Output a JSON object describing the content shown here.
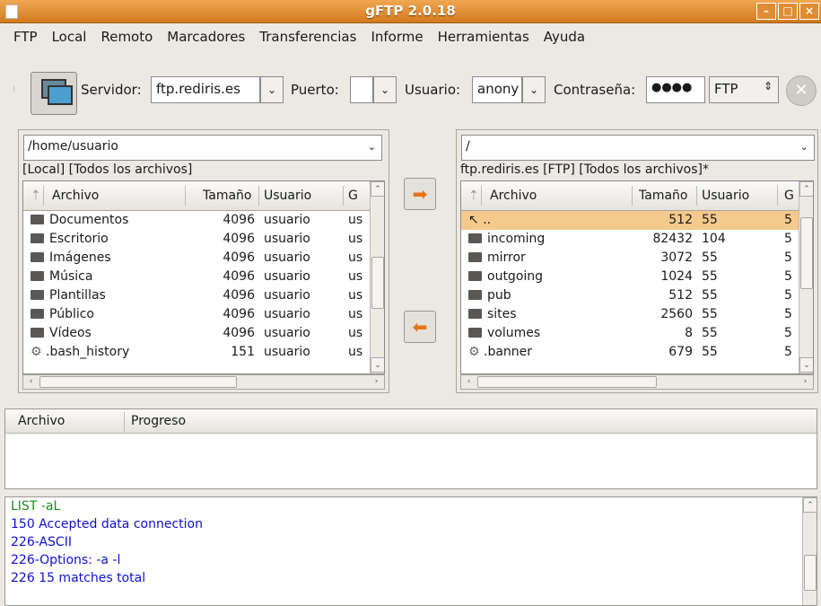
{
  "window": {
    "title": "gFTP 2.0.18"
  },
  "menu": [
    "FTP",
    "Local",
    "Remoto",
    "Marcadores",
    "Transferencias",
    "Informe",
    "Herramientas",
    "Ayuda"
  ],
  "toolbar": {
    "server_label": "Servidor:",
    "server_value": "ftp.rediris.es",
    "port_label": "Puerto:",
    "port_value": "",
    "user_label": "Usuario:",
    "user_value": "anony",
    "password_label": "Contraseña:",
    "password_value": "●●●●",
    "protocol": "FTP"
  },
  "local": {
    "path": "/home/usuario",
    "status": "[Local] [Todos los archivos]",
    "columns": [
      "Archivo",
      "Tamaño",
      "Usuario",
      "G"
    ],
    "files": [
      {
        "name": "Documentos",
        "size": "4096",
        "user": "usuario",
        "group": "us",
        "type": "folder"
      },
      {
        "name": "Escritorio",
        "size": "4096",
        "user": "usuario",
        "group": "us",
        "type": "folder"
      },
      {
        "name": "Imágenes",
        "size": "4096",
        "user": "usuario",
        "group": "us",
        "type": "folder"
      },
      {
        "name": "Música",
        "size": "4096",
        "user": "usuario",
        "group": "us",
        "type": "folder"
      },
      {
        "name": "Plantillas",
        "size": "4096",
        "user": "usuario",
        "group": "us",
        "type": "folder"
      },
      {
        "name": "Público",
        "size": "4096",
        "user": "usuario",
        "group": "us",
        "type": "folder"
      },
      {
        "name": "Vídeos",
        "size": "4096",
        "user": "usuario",
        "group": "us",
        "type": "folder"
      },
      {
        "name": ".bash_history",
        "size": "151",
        "user": "usuario",
        "group": "us",
        "type": "file"
      }
    ]
  },
  "remote": {
    "path": "/",
    "status": "ftp.rediris.es [FTP] [Todos los archivos]*",
    "columns": [
      "Archivo",
      "Tamaño",
      "Usuario",
      "G"
    ],
    "files": [
      {
        "name": "..",
        "size": "512",
        "user": "55",
        "group": "5",
        "type": "up"
      },
      {
        "name": "incoming",
        "size": "82432",
        "user": "104",
        "group": "5",
        "type": "folder"
      },
      {
        "name": "mirror",
        "size": "3072",
        "user": "55",
        "group": "5",
        "type": "folder"
      },
      {
        "name": "outgoing",
        "size": "1024",
        "user": "55",
        "group": "5",
        "type": "folder"
      },
      {
        "name": "pub",
        "size": "512",
        "user": "55",
        "group": "5",
        "type": "folder"
      },
      {
        "name": "sites",
        "size": "2560",
        "user": "55",
        "group": "5",
        "type": "folder"
      },
      {
        "name": "volumes",
        "size": "8",
        "user": "55",
        "group": "5",
        "type": "folder"
      },
      {
        "name": ".banner",
        "size": "679",
        "user": "55",
        "group": "5",
        "type": "file"
      }
    ]
  },
  "transfers": {
    "columns": [
      "Archivo",
      "Progreso"
    ]
  },
  "log": [
    {
      "text": "LIST -aL",
      "color": "#1c8a1c"
    },
    {
      "text": "150 Accepted data connection",
      "color": "#1010d0"
    },
    {
      "text": "226-ASCII",
      "color": "#1010d0"
    },
    {
      "text": "226-Options: -a -l",
      "color": "#1010d0"
    },
    {
      "text": "226 15 matches total",
      "color": "#1010d0"
    }
  ],
  "colors": {
    "titlebar": "#e08c34",
    "selected_row": "#f5c98c",
    "arrow": "#e27418"
  }
}
